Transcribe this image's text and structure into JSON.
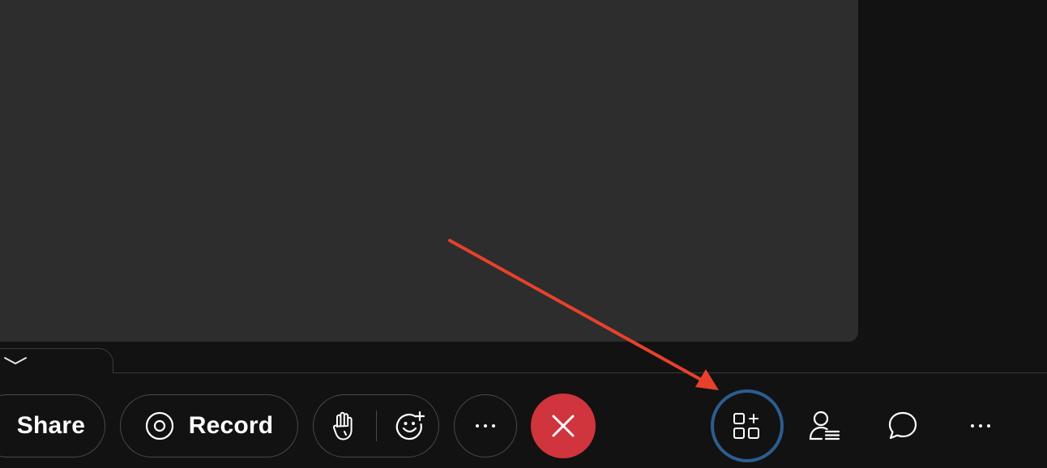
{
  "toolbar": {
    "share_label": "Share",
    "record_label": "Record",
    "end_call_color": "#d0343d"
  },
  "icons": {
    "collapse": "chevron-down-icon",
    "record": "record-icon",
    "raise_hand": "raise-hand-icon",
    "reactions": "add-reaction-icon",
    "more": "more-horizontal-icon",
    "end_call": "close-icon",
    "apps": "apps-add-icon",
    "participants": "participants-icon",
    "chat": "chat-icon",
    "more_right": "more-horizontal-icon"
  },
  "annotation": {
    "arrow_color": "#e8412b",
    "highlight_color": "#2c5d8f",
    "highlight_target": "apps-button"
  }
}
